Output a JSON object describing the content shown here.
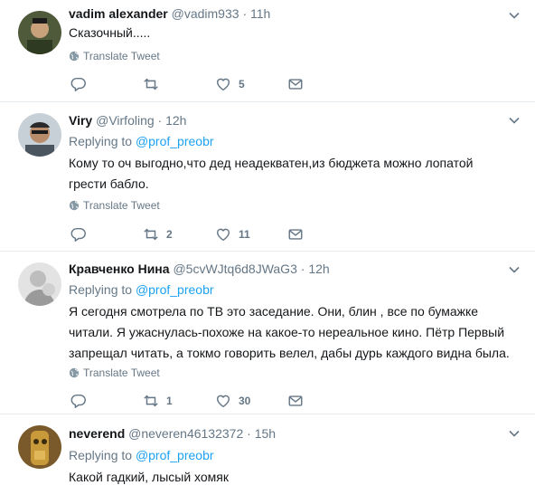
{
  "tweets": [
    {
      "name": "vadim alexander",
      "handle": "@vadim933",
      "time": "11h",
      "replying_prefix": "",
      "replying_to": "",
      "text_lines": [
        "Сказочный....."
      ],
      "translate": "Translate Tweet",
      "reply_count": "",
      "retweet_count": "",
      "like_count": "5"
    },
    {
      "name": "Viry",
      "handle": "@Virfoling",
      "time": "12h",
      "replying_prefix": "Replying to",
      "replying_to": "@prof_preobr",
      "text_lines": [
        "Кому то оч выгодно,что дед неадекватен,из бюджета можно лопатой",
        "грести бабло."
      ],
      "translate": "Translate Tweet",
      "reply_count": "",
      "retweet_count": "2",
      "like_count": "11"
    },
    {
      "name": "Кравченко Нина",
      "handle": "@5cvWJtq6d8JWaG3",
      "time": "12h",
      "replying_prefix": "Replying to",
      "replying_to": "@prof_preobr",
      "text_lines": [
        "Я сегодня смотрела по ТВ  это заседание. Они, блин , все по бумажке",
        "читали. Я ужаснулась-похоже на  какое-то нереальное  кино. Пётр Первый",
        "запрещал читать, а токмо говорить велел,  дабы дурь каждого видна была."
      ],
      "translate": "Translate Tweet",
      "reply_count": "",
      "retweet_count": "1",
      "like_count": "30"
    },
    {
      "name": "neverend",
      "handle": "@neveren46132372",
      "time": "15h",
      "replying_prefix": "Replying to",
      "replying_to": "@prof_preobr",
      "text_lines": [
        "Какой гадкий, лысый хомяк"
      ],
      "translate": "",
      "reply_count": "",
      "retweet_count": "",
      "like_count": ""
    }
  ]
}
